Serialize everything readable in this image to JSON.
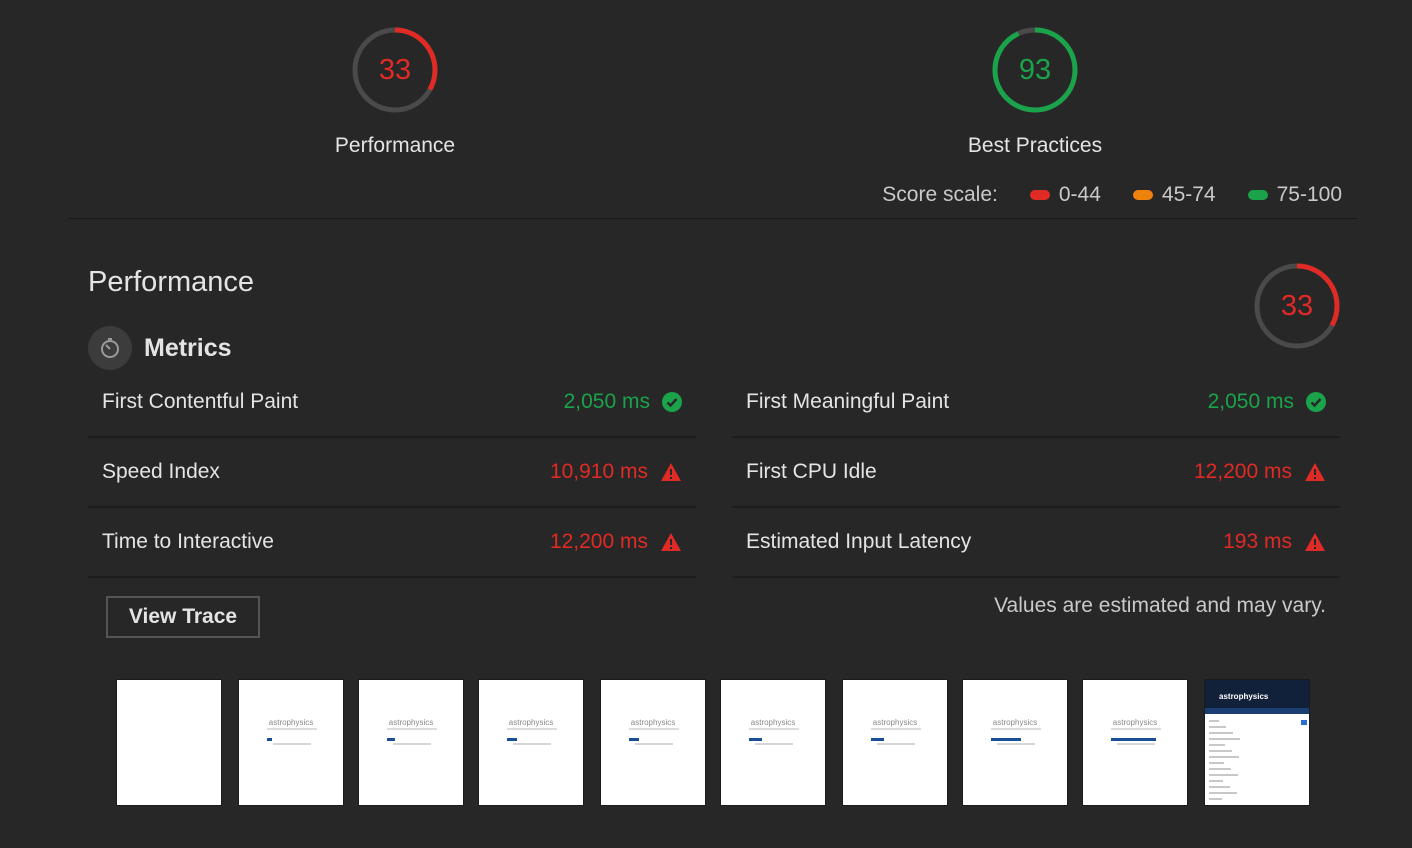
{
  "summary": {
    "performance": {
      "score": "33",
      "label": "Performance",
      "fraction": 0.33,
      "color": "#e02a25"
    },
    "best_practices": {
      "score": "93",
      "label": "Best Practices",
      "fraction": 0.93,
      "color": "#1aa34a"
    }
  },
  "scale": {
    "title": "Score scale:",
    "ranges": [
      {
        "label": "0-44",
        "color": "#e02a25"
      },
      {
        "label": "45-74",
        "color": "#ef820d"
      },
      {
        "label": "75-100",
        "color": "#1aa34a"
      }
    ]
  },
  "category": {
    "title": "Performance",
    "score": "33",
    "fraction": 0.33
  },
  "metrics": {
    "title": "Metrics",
    "icon": "stopwatch-icon",
    "left": [
      {
        "label": "First Contentful Paint",
        "value": "2,050 ms",
        "status": "pass"
      },
      {
        "label": "Speed Index",
        "value": "10,910 ms",
        "status": "fail"
      },
      {
        "label": "Time to Interactive",
        "value": "12,200 ms",
        "status": "fail"
      }
    ],
    "right": [
      {
        "label": "First Meaningful Paint",
        "value": "2,050 ms",
        "status": "pass"
      },
      {
        "label": "First CPU Idle",
        "value": "12,200 ms",
        "status": "fail"
      },
      {
        "label": "Estimated Input Latency",
        "value": "193 ms",
        "status": "fail"
      }
    ]
  },
  "actions": {
    "view_trace": "View Trace"
  },
  "note": "Values are estimated and may vary.",
  "filmstrip": {
    "frame_text": "astrophysics",
    "final_brand": "astrophysics",
    "frames": [
      {
        "kind": "blank"
      },
      {
        "kind": "loading",
        "progress": 0.1
      },
      {
        "kind": "loading",
        "progress": 0.15
      },
      {
        "kind": "loading",
        "progress": 0.2
      },
      {
        "kind": "loading",
        "progress": 0.2
      },
      {
        "kind": "loading",
        "progress": 0.25
      },
      {
        "kind": "loading",
        "progress": 0.25
      },
      {
        "kind": "loading",
        "progress": 0.6
      },
      {
        "kind": "loading",
        "progress": 0.9
      },
      {
        "kind": "final"
      }
    ]
  }
}
